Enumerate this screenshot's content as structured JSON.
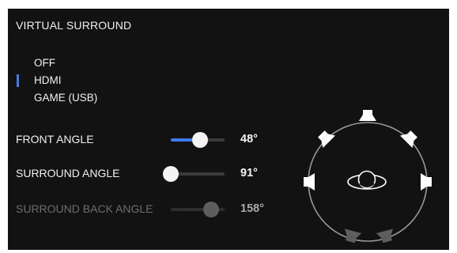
{
  "panel": {
    "title": "VIRTUAL SURROUND"
  },
  "modes": {
    "items": [
      {
        "label": "OFF"
      },
      {
        "label": "HDMI"
      },
      {
        "label": "GAME (USB)"
      }
    ],
    "selected": "HDMI"
  },
  "sliders": {
    "front_angle": {
      "label": "FRONT ANGLE",
      "value_text": "48°",
      "level": 0.55,
      "state": "active"
    },
    "surround_angle": {
      "label": "SURROUND ANGLE",
      "value_text": "91°",
      "level": 0.0,
      "state": "normal"
    },
    "surround_back_angle": {
      "label": "SURROUND BACK ANGLE",
      "value_text": "158°",
      "level": 0.75,
      "state": "disabled"
    }
  },
  "diagram": {
    "listener_icon": "headphones-listener-icon",
    "speakers": [
      "front-center",
      "front-left",
      "front-right",
      "surround-left",
      "surround-right",
      "surround-back-left",
      "surround-back-right"
    ]
  },
  "colors": {
    "accent": "#3d7bf2",
    "panel_bg": "#131212",
    "text": "#f0f0f0",
    "disabled_text": "#6d6d6d"
  }
}
